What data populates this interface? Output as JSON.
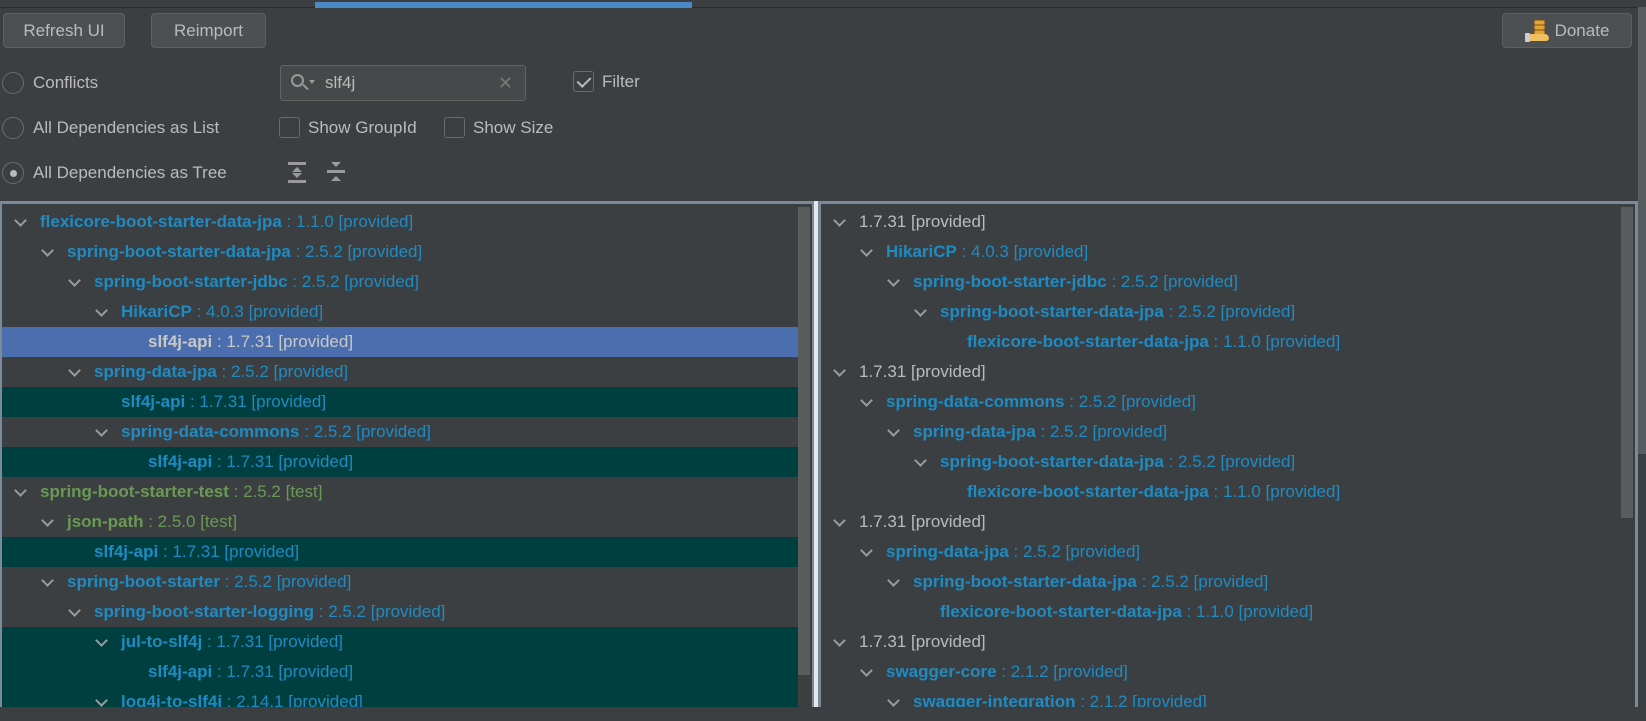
{
  "toolbar": {
    "refresh_label": "Refresh UI",
    "reimport_label": "Reimport",
    "donate_label": "Donate",
    "donate_icon": "coin-hand-icon"
  },
  "modes": [
    {
      "label": "Conflicts",
      "selected": false
    },
    {
      "label": "All Dependencies as List",
      "selected": false
    },
    {
      "label": "All Dependencies as Tree",
      "selected": true
    }
  ],
  "search": {
    "value": "slf4j",
    "placeholder": "",
    "icon": "search-icon",
    "clear_icon": "close-icon"
  },
  "options": {
    "filter": {
      "label": "Filter",
      "checked": true
    },
    "show_group_id": {
      "label": "Show GroupId",
      "checked": false
    },
    "show_size": {
      "label": "Show Size",
      "checked": false
    }
  },
  "tree_tools": {
    "expand_all": "expand-all-icon",
    "collapse_all": "collapse-all-icon"
  },
  "colors": {
    "accent_blue": "#1e8bc3",
    "test_green": "#6a9955",
    "selection": "#4b6eaf",
    "match_highlight": "#003f3f",
    "background": "#3c3f41"
  },
  "left_tree": [
    {
      "depth": 0,
      "expanded": true,
      "name": "flexicore-boot-starter-data-jpa",
      "version": " : 1.1.0 [provided]",
      "scope": "provided",
      "state": "normal"
    },
    {
      "depth": 1,
      "expanded": true,
      "name": "spring-boot-starter-data-jpa",
      "version": " : 2.5.2 [provided]",
      "scope": "provided",
      "state": "normal"
    },
    {
      "depth": 2,
      "expanded": true,
      "name": "spring-boot-starter-jdbc",
      "version": " : 2.5.2 [provided]",
      "scope": "provided",
      "state": "normal"
    },
    {
      "depth": 3,
      "expanded": true,
      "name": "HikariCP",
      "version": " : 4.0.3 [provided]",
      "scope": "provided",
      "state": "normal"
    },
    {
      "depth": 4,
      "expanded": false,
      "name": "slf4j-api",
      "version": " : 1.7.31 [provided]",
      "scope": "provided",
      "state": "selected"
    },
    {
      "depth": 2,
      "expanded": true,
      "name": "spring-data-jpa",
      "version": " : 2.5.2 [provided]",
      "scope": "provided",
      "state": "normal"
    },
    {
      "depth": 3,
      "expanded": false,
      "name": "slf4j-api",
      "version": " : 1.7.31 [provided]",
      "scope": "provided",
      "state": "match"
    },
    {
      "depth": 3,
      "expanded": true,
      "name": "spring-data-commons",
      "version": " : 2.5.2 [provided]",
      "scope": "provided",
      "state": "normal"
    },
    {
      "depth": 4,
      "expanded": false,
      "name": "slf4j-api",
      "version": " : 1.7.31 [provided]",
      "scope": "provided",
      "state": "match"
    },
    {
      "depth": 0,
      "expanded": true,
      "name": "spring-boot-starter-test",
      "version": " : 2.5.2 [test]",
      "scope": "test",
      "state": "normal"
    },
    {
      "depth": 1,
      "expanded": true,
      "name": "json-path",
      "version": " : 2.5.0 [test]",
      "scope": "test",
      "state": "normal"
    },
    {
      "depth": 2,
      "expanded": false,
      "name": "slf4j-api",
      "version": " : 1.7.31 [provided]",
      "scope": "provided",
      "state": "match"
    },
    {
      "depth": 1,
      "expanded": true,
      "name": "spring-boot-starter",
      "version": " : 2.5.2 [provided]",
      "scope": "provided",
      "state": "normal"
    },
    {
      "depth": 2,
      "expanded": true,
      "name": "spring-boot-starter-logging",
      "version": " : 2.5.2 [provided]",
      "scope": "provided",
      "state": "normal"
    },
    {
      "depth": 3,
      "expanded": true,
      "name": "jul-to-slf4j",
      "version": " : 1.7.31 [provided]",
      "scope": "provided",
      "state": "match"
    },
    {
      "depth": 4,
      "expanded": false,
      "name": "slf4j-api",
      "version": " : 1.7.31 [provided]",
      "scope": "provided",
      "state": "match"
    },
    {
      "depth": 3,
      "expanded": true,
      "name": "log4j-to-slf4j",
      "version": " : 2.14.1 [provided]",
      "scope": "provided",
      "state": "match"
    }
  ],
  "right_tree": [
    {
      "depth": 0,
      "expanded": true,
      "name": "",
      "version": "1.7.31 [provided]",
      "scope": "plain"
    },
    {
      "depth": 1,
      "expanded": true,
      "name": "HikariCP",
      "version": " : 4.0.3 [provided]",
      "scope": "provided"
    },
    {
      "depth": 2,
      "expanded": true,
      "name": "spring-boot-starter-jdbc",
      "version": " : 2.5.2 [provided]",
      "scope": "provided"
    },
    {
      "depth": 3,
      "expanded": true,
      "name": "spring-boot-starter-data-jpa",
      "version": " : 2.5.2 [provided]",
      "scope": "provided"
    },
    {
      "depth": 4,
      "expanded": false,
      "name": "flexicore-boot-starter-data-jpa",
      "version": " : 1.1.0 [provided]",
      "scope": "provided"
    },
    {
      "depth": 0,
      "expanded": true,
      "name": "",
      "version": "1.7.31 [provided]",
      "scope": "plain"
    },
    {
      "depth": 1,
      "expanded": true,
      "name": "spring-data-commons",
      "version": " : 2.5.2 [provided]",
      "scope": "provided"
    },
    {
      "depth": 2,
      "expanded": true,
      "name": "spring-data-jpa",
      "version": " : 2.5.2 [provided]",
      "scope": "provided"
    },
    {
      "depth": 3,
      "expanded": true,
      "name": "spring-boot-starter-data-jpa",
      "version": " : 2.5.2 [provided]",
      "scope": "provided"
    },
    {
      "depth": 4,
      "expanded": false,
      "name": "flexicore-boot-starter-data-jpa",
      "version": " : 1.1.0 [provided]",
      "scope": "provided"
    },
    {
      "depth": 0,
      "expanded": true,
      "name": "",
      "version": "1.7.31 [provided]",
      "scope": "plain"
    },
    {
      "depth": 1,
      "expanded": true,
      "name": "spring-data-jpa",
      "version": " : 2.5.2 [provided]",
      "scope": "provided"
    },
    {
      "depth": 2,
      "expanded": true,
      "name": "spring-boot-starter-data-jpa",
      "version": " : 2.5.2 [provided]",
      "scope": "provided"
    },
    {
      "depth": 3,
      "expanded": false,
      "name": "flexicore-boot-starter-data-jpa",
      "version": " : 1.1.0 [provided]",
      "scope": "provided"
    },
    {
      "depth": 0,
      "expanded": true,
      "name": "",
      "version": "1.7.31 [provided]",
      "scope": "plain"
    },
    {
      "depth": 1,
      "expanded": true,
      "name": "swagger-core",
      "version": " : 2.1.2 [provided]",
      "scope": "provided"
    },
    {
      "depth": 2,
      "expanded": true,
      "name": "swagger-integration",
      "version": " : 2.1.2 [provided]",
      "scope": "provided"
    }
  ]
}
